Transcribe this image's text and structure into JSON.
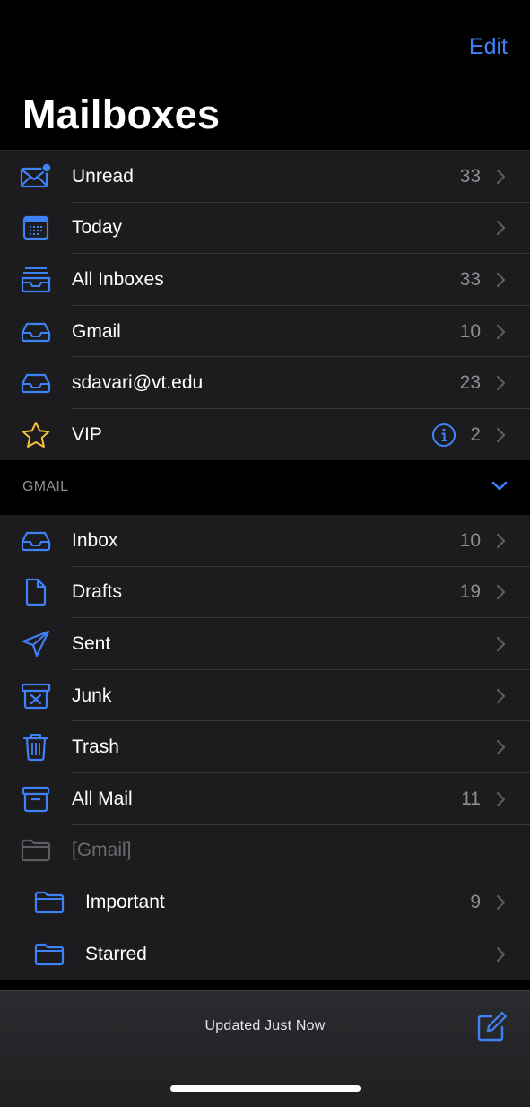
{
  "header": {
    "edit_label": "Edit",
    "title": "Mailboxes"
  },
  "top_mailboxes": [
    {
      "label": "Unread",
      "count": "33",
      "icon": "unread-envelope-icon"
    },
    {
      "label": "Today",
      "count": "",
      "icon": "calendar-icon"
    },
    {
      "label": "All Inboxes",
      "count": "33",
      "icon": "all-inboxes-tray-icon"
    },
    {
      "label": "Gmail",
      "count": "10",
      "icon": "inbox-tray-icon"
    },
    {
      "label": "sdavari@vt.edu",
      "count": "23",
      "icon": "inbox-tray-icon"
    },
    {
      "label": "VIP",
      "count": "2",
      "icon": "star-icon"
    }
  ],
  "gmail_section": {
    "header": "GMAIL",
    "items": [
      {
        "label": "Inbox",
        "count": "10",
        "icon": "inbox-tray-icon"
      },
      {
        "label": "Drafts",
        "count": "19",
        "icon": "document-icon"
      },
      {
        "label": "Sent",
        "count": "",
        "icon": "paper-plane-icon"
      },
      {
        "label": "Junk",
        "count": "",
        "icon": "junk-bin-icon"
      },
      {
        "label": "Trash",
        "count": "",
        "icon": "trash-icon"
      },
      {
        "label": "All Mail",
        "count": "11",
        "icon": "archive-box-icon"
      },
      {
        "label": "[Gmail]",
        "count": "",
        "icon": "folder-icon"
      },
      {
        "label": "Important",
        "count": "9",
        "icon": "folder-icon"
      },
      {
        "label": "Starred",
        "count": "",
        "icon": "folder-icon"
      }
    ]
  },
  "bottom_bar": {
    "status": "Updated Just Now",
    "compose_icon": "compose-icon"
  },
  "colors": {
    "accent": "#3f82f7",
    "vip_star": "#f5c33b",
    "background": "#000000",
    "row_background": "#1c1c1e"
  }
}
